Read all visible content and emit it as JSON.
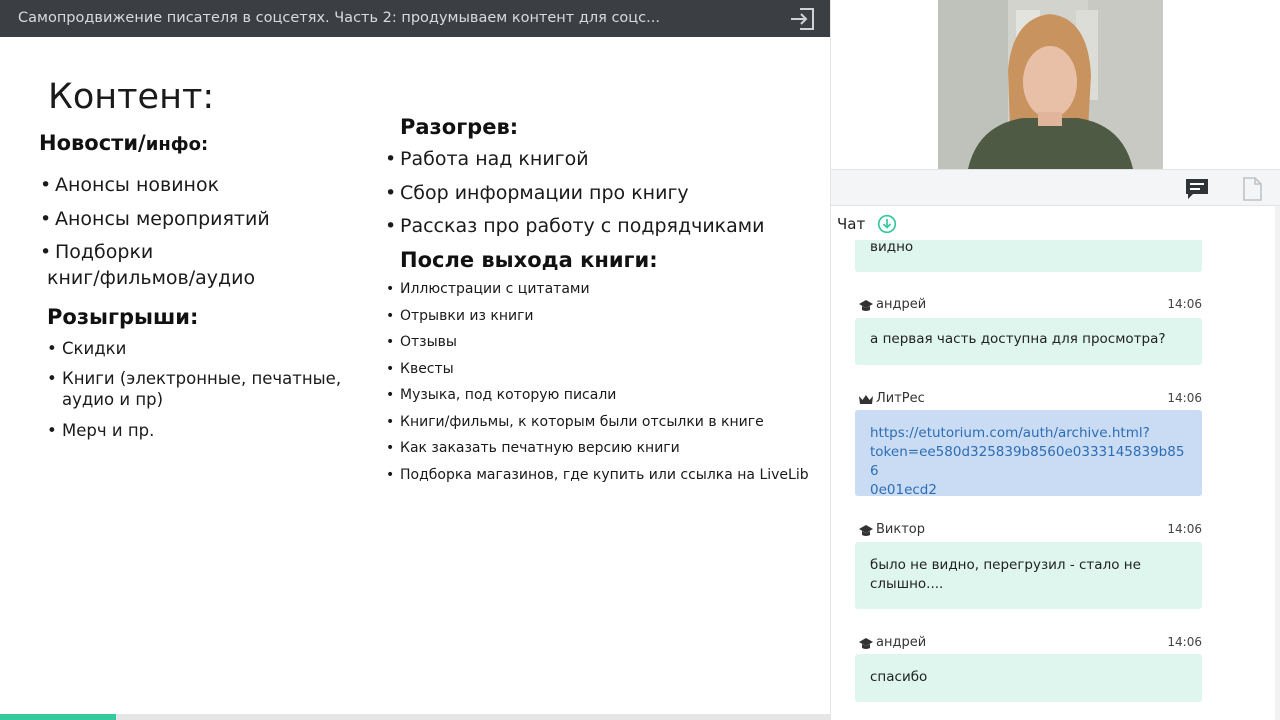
{
  "header": {
    "title": "Самопродвижение писателя в соцсетях. Часть 2: продумываем контент для соцс..."
  },
  "slide": {
    "heading": "Контент:",
    "news_title_a": "Новости/",
    "news_title_b": "инфо:",
    "news_items": [
      "Анонсы новинок",
      "Анонсы мероприятий",
      "Подборки",
      "книг/фильмов/аудио"
    ],
    "giveaways_title": "Розыгрыши:",
    "giveaways_items": [
      "Скидки",
      "Книги (электронные, печатные,",
      "аудио и пр)",
      "Мерч и пр."
    ],
    "warmup_title": "Разогрев:",
    "warmup_items": [
      "Работа над книгой",
      "Сбор информации про книгу",
      "Рассказ про работу с подрядчиками"
    ],
    "after_title": "После выхода книги:",
    "after_items": [
      "Иллюстрации с цитатами",
      "Отрывки из книги",
      "Отзывы",
      "Квесты",
      "Музыка, под которую писали",
      "Книги/фильмы, к которым были отсылки в книге",
      "Как заказать печатную версию книги",
      "Подборка магазинов, где купить или ссылка на LiveLib"
    ]
  },
  "progress": {
    "value_percent": 14
  },
  "chat": {
    "label": "Чат",
    "messages": [
      {
        "author": "",
        "time": "",
        "text": "видно",
        "icon": "none"
      },
      {
        "author": "андрей",
        "time": "14:06",
        "text": "а первая часть доступна для просмотра?",
        "icon": "graduation-cap-icon"
      },
      {
        "author": "ЛитРес",
        "time": "14:06",
        "text_lines": [
          "https://etutorium.com/auth/archive.html?",
          "token=ee580d325839b8560e0333145839b856",
          "0e01ecd2"
        ],
        "icon": "crown-icon",
        "is_link": true
      },
      {
        "author": "Виктор",
        "time": "14:06",
        "text_lines": [
          "было не видно, перегрузил - стало не",
          "слышно...."
        ],
        "icon": "graduation-cap-icon"
      },
      {
        "author": "андрей",
        "time": "14:06",
        "text": "спасибо",
        "icon": "graduation-cap-icon"
      }
    ]
  },
  "colors": {
    "topbar": "#3b3f44",
    "accent": "#35c9a0",
    "bubble_green": "#def6ee",
    "bubble_blue": "#c9dcf3",
    "link": "#2d6db4"
  }
}
